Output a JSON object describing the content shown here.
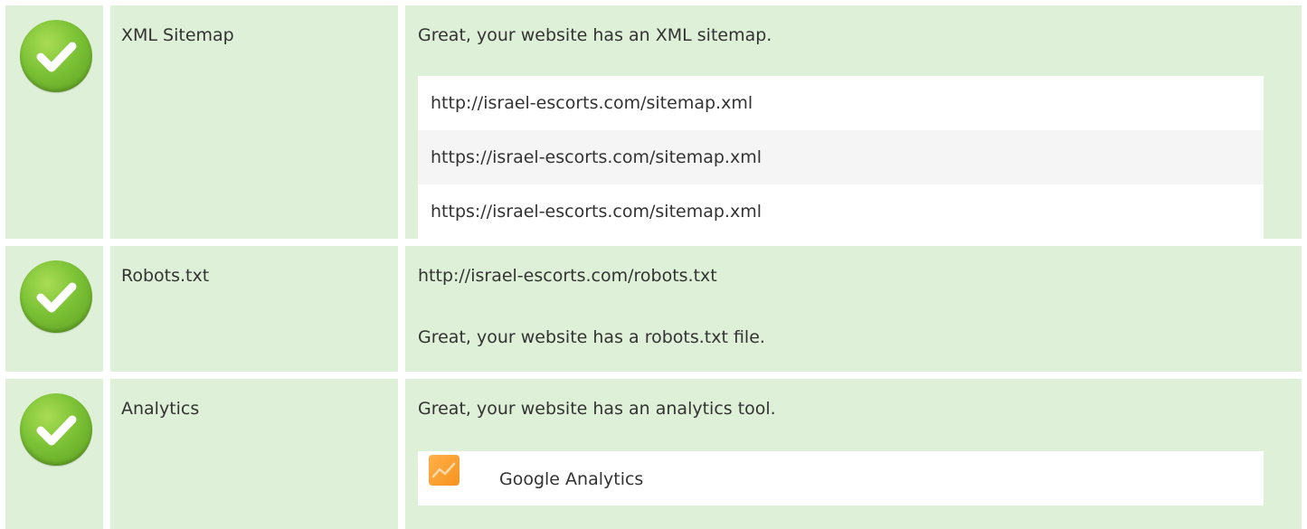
{
  "rows": [
    {
      "name": "XML Sitemap",
      "message": "Great, your website has an XML sitemap.",
      "status_icon": "check-circle-icon",
      "sitemaps": [
        "http://israel-escorts.com/sitemap.xml",
        "https://israel-escorts.com/sitemap.xml",
        "https://israel-escorts.com/sitemap.xml"
      ]
    },
    {
      "name": "Robots.txt",
      "url": "http://israel-escorts.com/robots.txt",
      "message": "Great, your website has a robots.txt file.",
      "status_icon": "check-circle-icon"
    },
    {
      "name": "Analytics",
      "message": "Great, your website has an analytics tool.",
      "status_icon": "check-circle-icon",
      "tool": {
        "name": "Google Analytics",
        "icon": "google-analytics-icon"
      }
    }
  ],
  "colors": {
    "row_background": "#dff0d8",
    "check_green": "#7cc236",
    "list_alt_background": "#f5f5f5",
    "analytics_orange": "#f7931e"
  }
}
